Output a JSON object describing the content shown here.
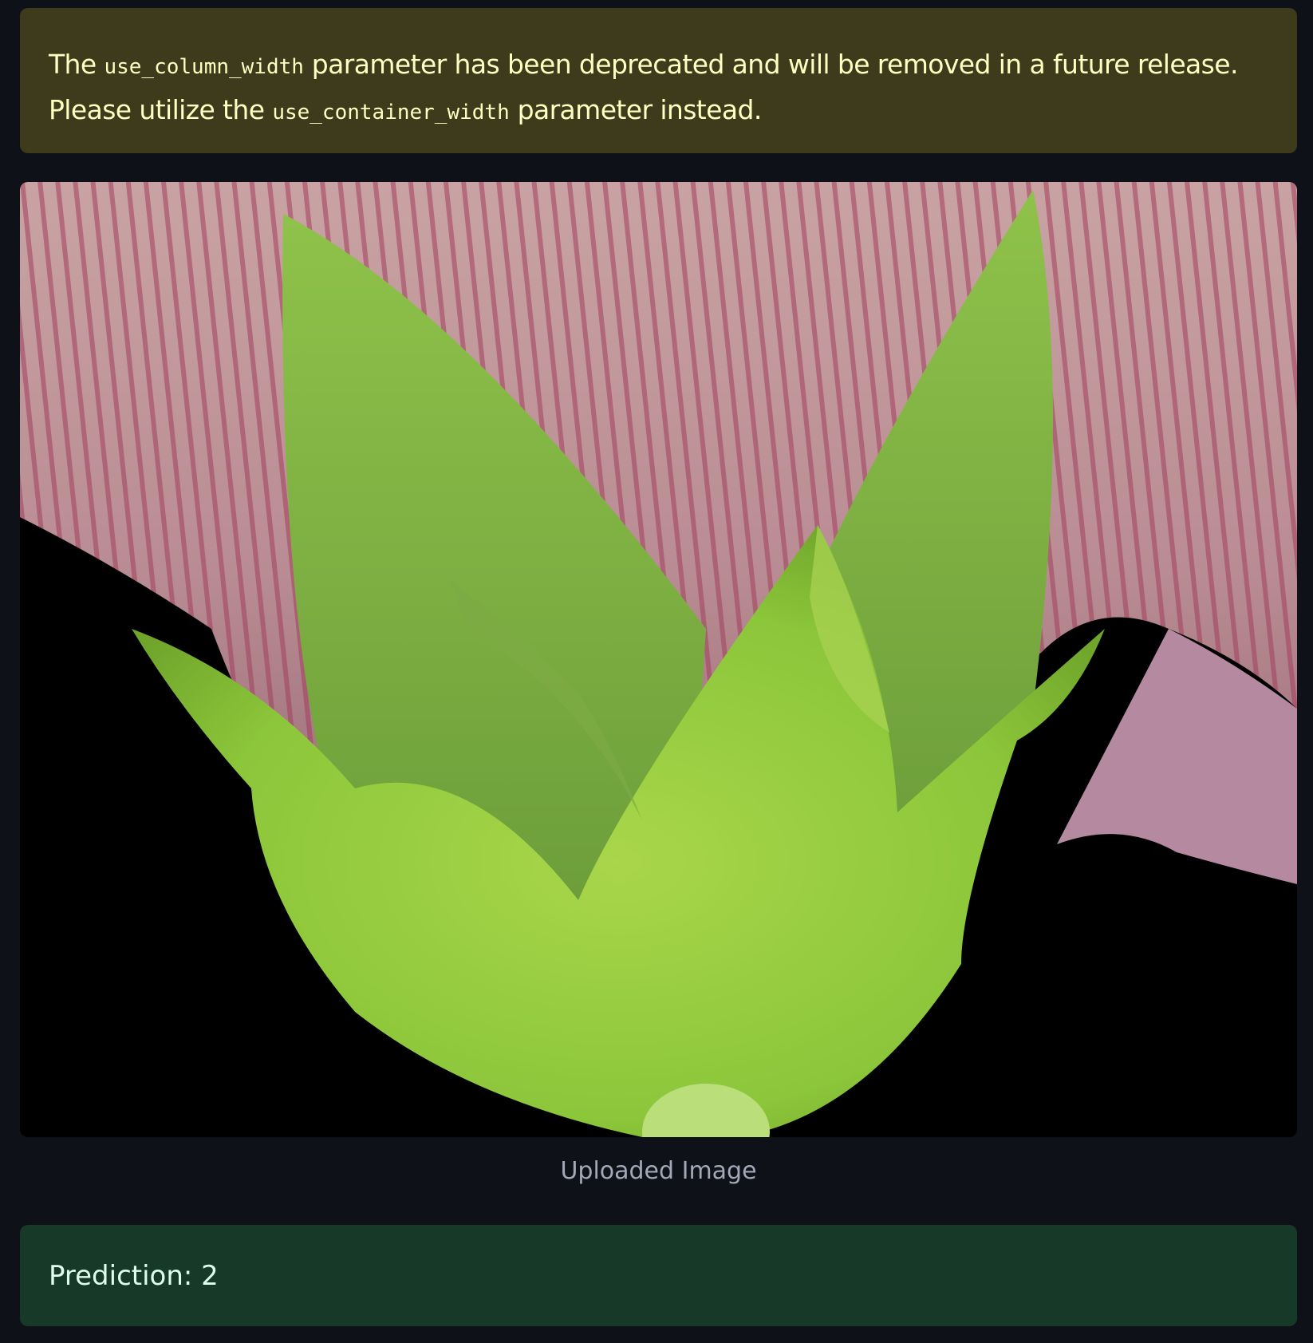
{
  "warning": {
    "part1": "The ",
    "code1": "use_column_width",
    "part2": " parameter has been deprecated and will be removed in a future release. Please utilize the ",
    "code2": "use_container_width",
    "part3": " parameter instead.",
    "color": "#3d3b1c"
  },
  "image": {
    "alt": "Uploaded Image"
  },
  "caption": "Uploaded Image",
  "prediction": {
    "text": "Prediction: 2",
    "color": "#173928"
  }
}
